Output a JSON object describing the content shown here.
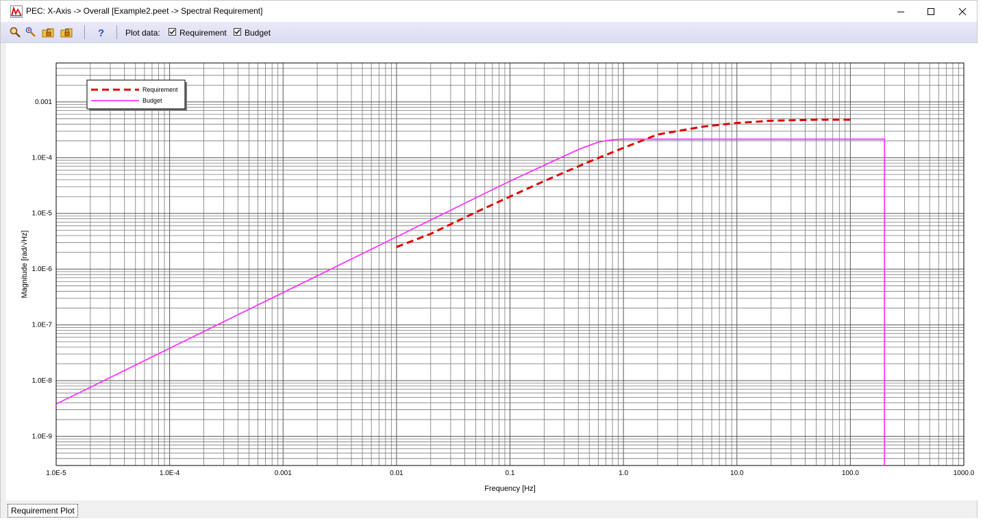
{
  "window": {
    "title": "PEC: X-Axis -> Overall  [Example2.peet -> Spectral Requirement]",
    "buttons": [
      "minimize",
      "maximize",
      "close"
    ]
  },
  "toolbar": {
    "icons": [
      "zoom-in-icon",
      "zoom-pen-icon",
      "unlock-folder-icon",
      "lock-folder-icon",
      "help-icon"
    ],
    "plot_data_label": "Plot data:",
    "checkbox_requirement": {
      "label": "Requirement",
      "checked": true
    },
    "checkbox_budget": {
      "label": "Budget",
      "checked": true
    }
  },
  "status_bar": {
    "tab_label": "Requirement Plot"
  },
  "chart_data": {
    "type": "line",
    "xscale": "log",
    "yscale": "log",
    "xlabel": "Frequency [Hz]",
    "ylabel": "Magnitude [rad/√Hz]",
    "xlim": [
      1e-05,
      1000
    ],
    "ylim": [
      3e-10,
      0.005
    ],
    "xticks": [
      1e-05,
      0.0001,
      0.001,
      0.01,
      0.1,
      1,
      10,
      100,
      1000
    ],
    "xtick_labels": [
      "1.0E-5",
      "1.0E-4",
      "0.001",
      "0.01",
      "0.1",
      "1.0",
      "10.0",
      "100.0",
      "1000.0"
    ],
    "yticks": [
      1e-09,
      1e-08,
      1e-07,
      1e-06,
      1e-05,
      0.0001,
      0.001
    ],
    "ytick_labels": [
      "1.0E-9",
      "1.0E-8",
      "1.0E-7",
      "1.0E-6",
      "1.0E-5",
      "1.0E-4",
      "0.001"
    ],
    "grid": true,
    "legend_position": "top-left",
    "series": [
      {
        "name": "Requirement",
        "color": "#e00000",
        "style": "dashed",
        "x": [
          0.01,
          0.02,
          0.05,
          0.1,
          0.2,
          0.5,
          1,
          2,
          5,
          10,
          20,
          50,
          100
        ],
        "y": [
          2.5e-06,
          4.3e-06,
          1.05e-05,
          2e-05,
          3.8e-05,
          8.5e-05,
          0.00015,
          0.00026,
          0.00036,
          0.00042,
          0.00046,
          0.00048,
          0.00048
        ]
      },
      {
        "name": "Budget",
        "color": "#ff33ff",
        "style": "solid",
        "x": [
          1e-05,
          0.0001,
          0.001,
          0.01,
          0.1,
          0.2,
          0.4,
          0.6,
          0.8,
          1,
          10,
          100,
          200,
          200
        ],
        "y": [
          3.8e-09,
          3.8e-08,
          3.8e-07,
          3.8e-06,
          3.8e-05,
          7.3e-05,
          0.00014,
          0.00019,
          0.00021,
          0.000215,
          0.000215,
          0.000215,
          0.000215,
          3e-10
        ]
      }
    ]
  }
}
